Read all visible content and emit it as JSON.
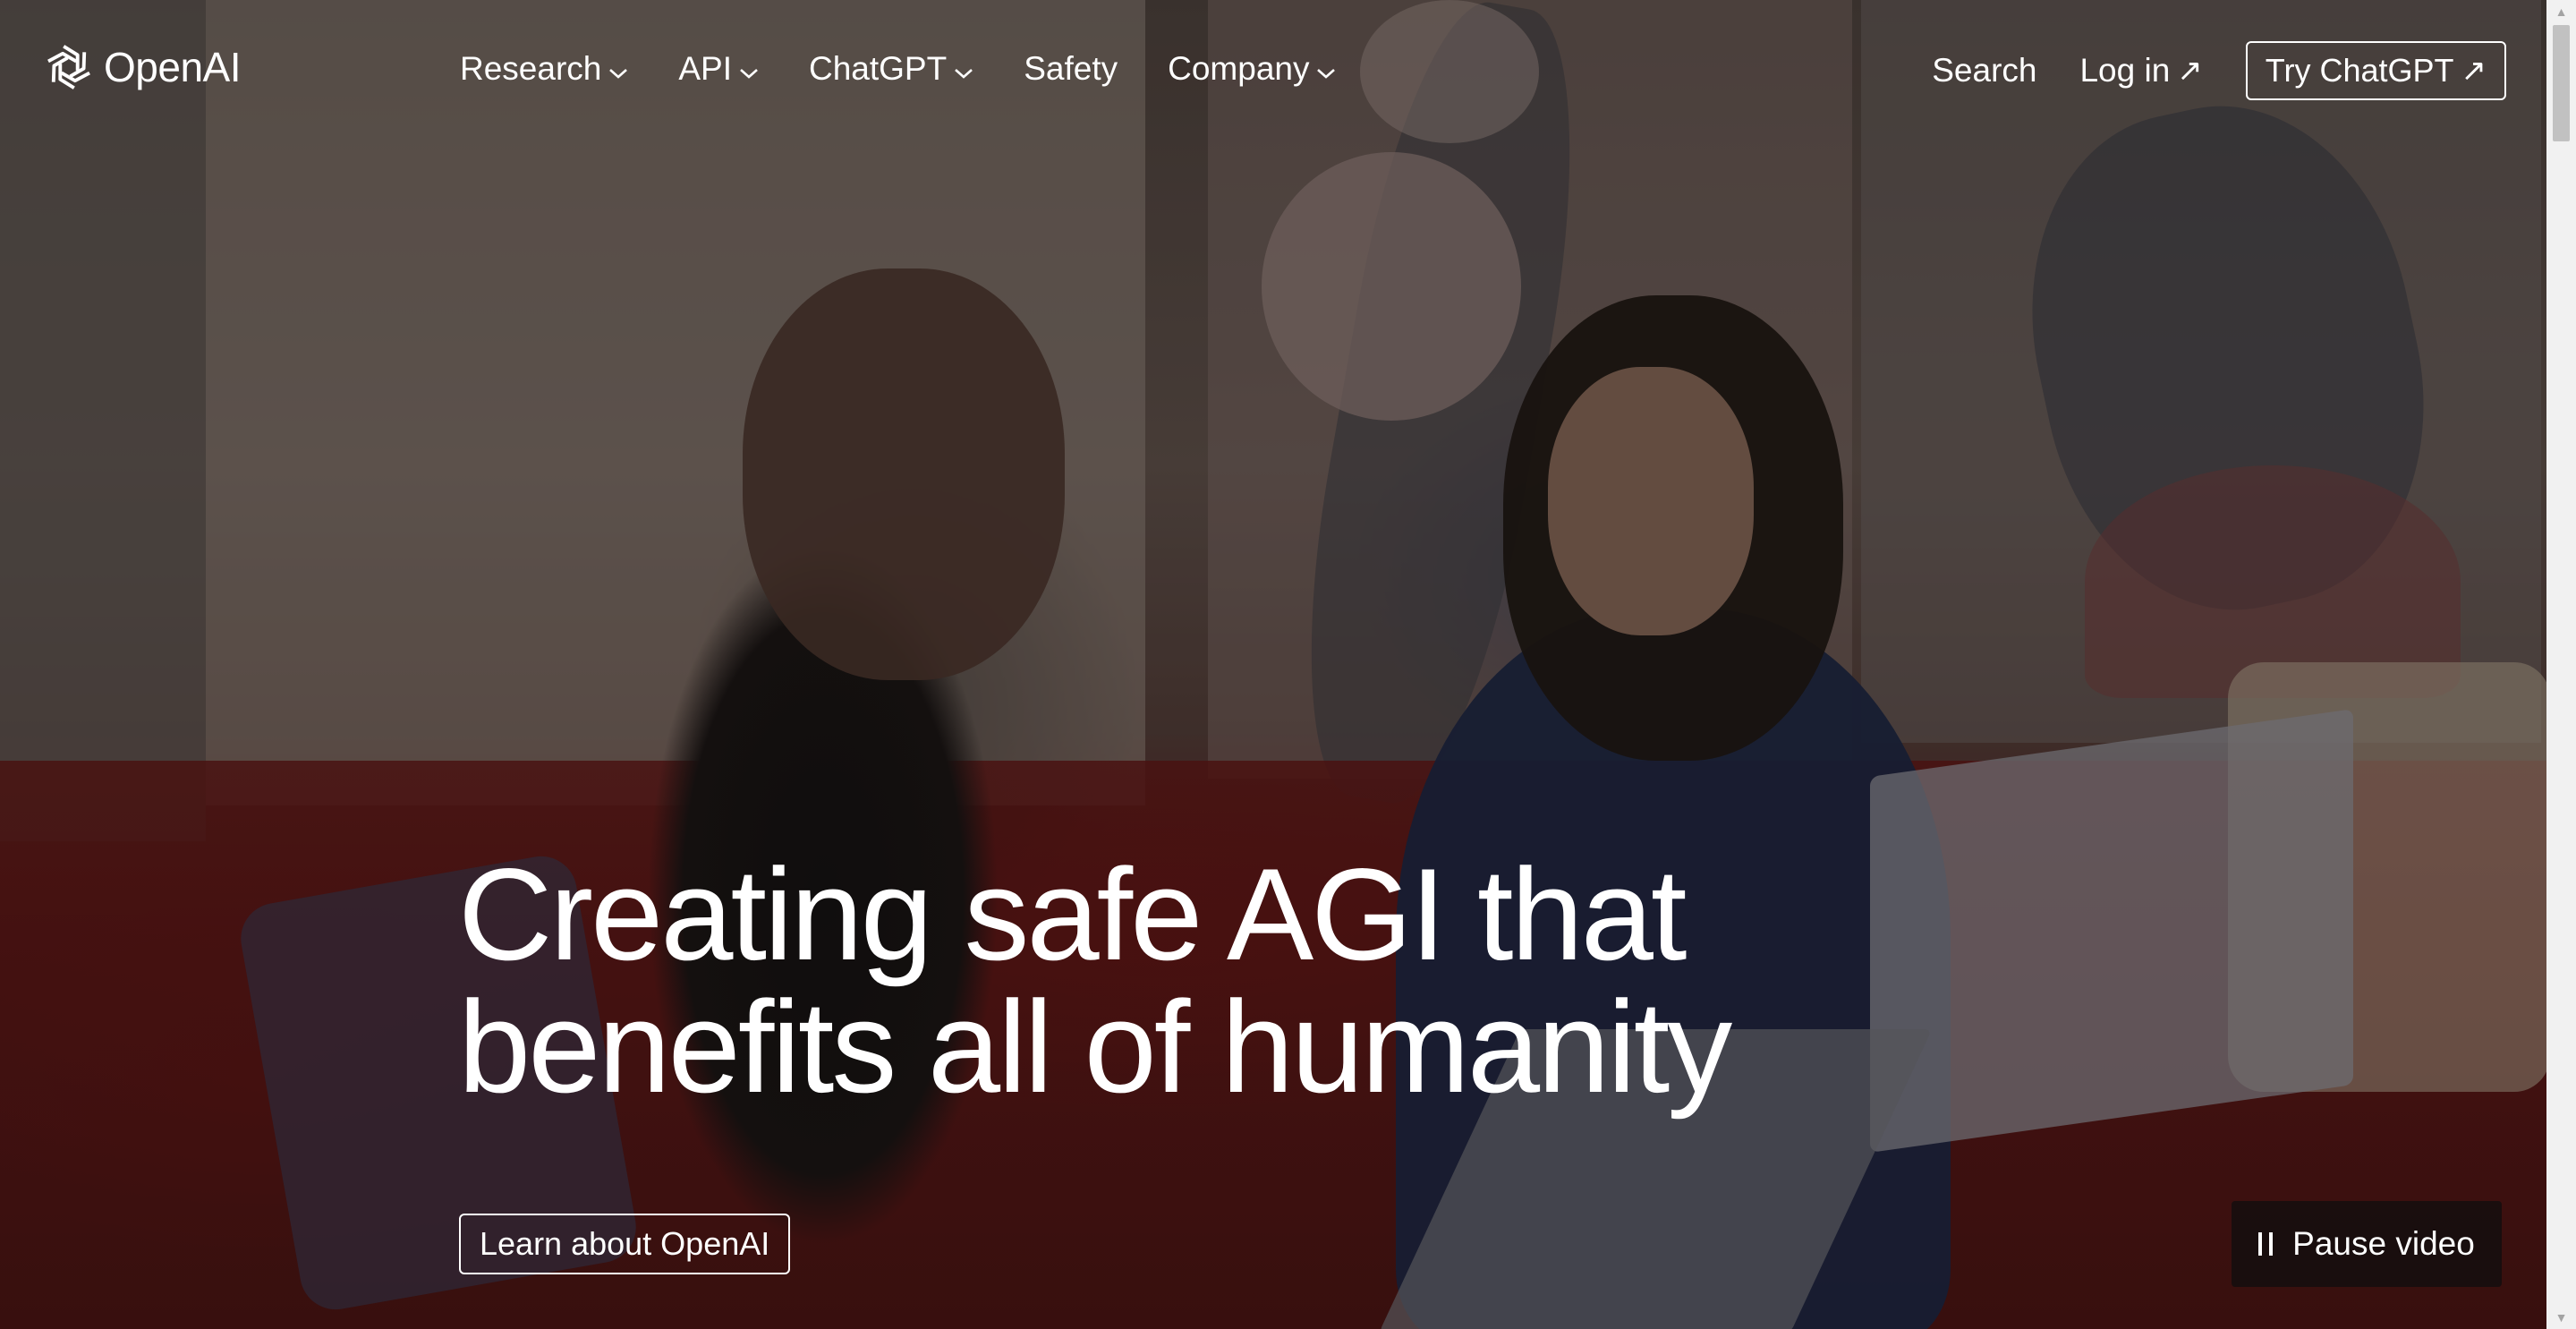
{
  "brand": {
    "name": "OpenAI",
    "logo_icon": "openai-logo-icon"
  },
  "nav": {
    "items": [
      {
        "label": "Research",
        "has_dropdown": true
      },
      {
        "label": "API",
        "has_dropdown": true
      },
      {
        "label": "ChatGPT",
        "has_dropdown": true
      },
      {
        "label": "Safety",
        "has_dropdown": false
      },
      {
        "label": "Company",
        "has_dropdown": true
      }
    ],
    "search_label": "Search",
    "login_label": "Log in",
    "try_label": "Try ChatGPT",
    "external_arrow": "↗"
  },
  "hero": {
    "headline_line1": "Creating safe AGI that",
    "headline_line2": "benefits all of humanity",
    "cta_label": "Learn about OpenAI",
    "pause_label": "Pause video"
  },
  "colors": {
    "text": "#ffffff",
    "pause_bg": "#140e0e",
    "scrollbar": "#f1f1f1"
  }
}
